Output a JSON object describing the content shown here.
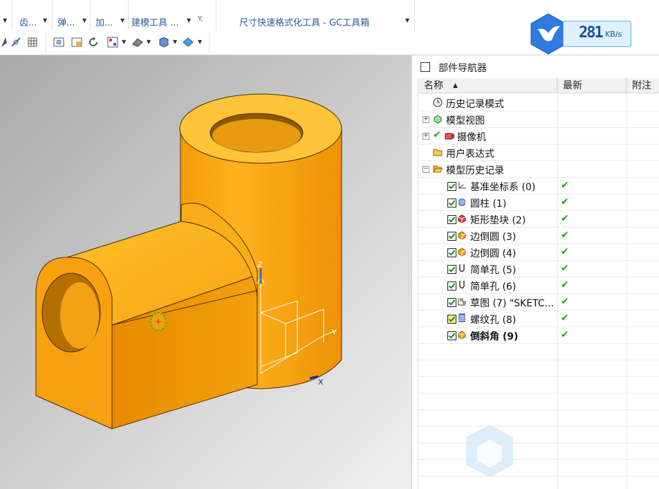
{
  "ribbon": {
    "items": [
      "齿...",
      "弹...",
      "加...",
      "建模工具 ...",
      "尺寸快速格式化工具 - GC工具箱"
    ]
  },
  "speed_widget": {
    "value": "281",
    "unit": "KB/s"
  },
  "navigator": {
    "title": "部件导航器",
    "columns": [
      "名称",
      "最新",
      "附注"
    ],
    "tree": [
      {
        "label": "历史记录模式",
        "icon": "clock-icon"
      },
      {
        "label": "模型视图",
        "icon": "model-view-icon"
      },
      {
        "label": "摄像机",
        "icon": "camera-icon"
      },
      {
        "label": "用户表达式",
        "icon": "folder-icon"
      },
      {
        "label": "模型历史记录",
        "icon": "folder-open-icon"
      }
    ],
    "features": [
      {
        "label": "基准坐标系 (0)",
        "icon": "datum-csys-icon",
        "latest": "✔"
      },
      {
        "label": "圆柱 (1)",
        "icon": "cylinder-icon",
        "latest": "✔"
      },
      {
        "label": "矩形垫块 (2)",
        "icon": "pad-icon",
        "latest": "✔"
      },
      {
        "label": "边倒圆 (3)",
        "icon": "edge-blend-icon",
        "latest": "✔"
      },
      {
        "label": "边倒圆 (4)",
        "icon": "edge-blend-icon",
        "latest": "✔"
      },
      {
        "label": "简单孔 (5)",
        "icon": "simple-hole-icon",
        "latest": "✔"
      },
      {
        "label": "简单孔 (6)",
        "icon": "simple-hole-icon",
        "latest": "✔"
      },
      {
        "label": "草图 (7) \"SKETC...",
        "icon": "sketch-icon",
        "latest": "✔"
      },
      {
        "label": "螺纹孔 (8)",
        "icon": "threaded-hole-icon",
        "latest": "✔"
      },
      {
        "label": "倒斜角 (9)",
        "icon": "chamfer-icon",
        "latest": "✔"
      }
    ]
  },
  "axes": {
    "x": "X",
    "y": "Y",
    "z": "Z"
  },
  "colors": {
    "part": "#f5a10a",
    "accent": "#2a5a9a",
    "check": "#22a022"
  }
}
